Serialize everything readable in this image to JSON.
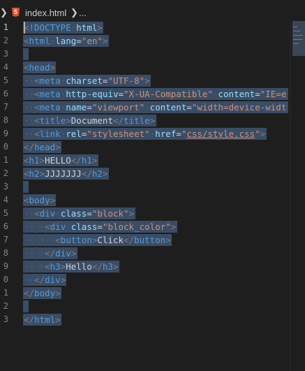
{
  "breadcrumb": {
    "file_icon": "html5-icon",
    "file_name": "index.html",
    "ellipsis": "..."
  },
  "line_numbers": [
    "1",
    "2",
    "3",
    "4",
    "5",
    "6",
    "7",
    "8",
    "9",
    "0",
    "1",
    "2",
    "3",
    "4",
    "5",
    "6",
    "7",
    "8",
    "9",
    "0",
    "1",
    "2",
    "3"
  ],
  "active_line": 1,
  "code_lines": [
    [
      {
        "t": "<",
        "c": "t-punct"
      },
      {
        "t": "!DOCTYPE",
        "c": "t-tag"
      },
      {
        "t": " ",
        "c": "ws"
      },
      {
        "t": "html",
        "c": "t-attr"
      },
      {
        "t": ">",
        "c": "t-punct"
      }
    ],
    [
      {
        "t": "<",
        "c": "t-punct"
      },
      {
        "t": "html",
        "c": "t-tag"
      },
      {
        "t": " ",
        "c": "ws"
      },
      {
        "t": "lang",
        "c": "t-attr"
      },
      {
        "t": "=",
        "c": "t-text"
      },
      {
        "t": "\"en\"",
        "c": "t-str"
      },
      {
        "t": ">",
        "c": "t-punct"
      }
    ],
    [],
    [
      {
        "t": "<",
        "c": "t-punct"
      },
      {
        "t": "head",
        "c": "t-tag"
      },
      {
        "t": ">",
        "c": "t-punct"
      }
    ],
    [
      {
        "t": "  ",
        "c": "ws"
      },
      {
        "t": "<",
        "c": "t-punct"
      },
      {
        "t": "meta",
        "c": "t-tag"
      },
      {
        "t": " ",
        "c": "ws"
      },
      {
        "t": "charset",
        "c": "t-attr"
      },
      {
        "t": "=",
        "c": "t-text"
      },
      {
        "t": "\"UTF-8\"",
        "c": "t-str"
      },
      {
        "t": ">",
        "c": "t-punct"
      }
    ],
    [
      {
        "t": "  ",
        "c": "ws"
      },
      {
        "t": "<",
        "c": "t-punct"
      },
      {
        "t": "meta",
        "c": "t-tag"
      },
      {
        "t": " ",
        "c": "ws"
      },
      {
        "t": "http-equiv",
        "c": "t-attr"
      },
      {
        "t": "=",
        "c": "t-text"
      },
      {
        "t": "\"X-UA-Compatible\"",
        "c": "t-str"
      },
      {
        "t": " ",
        "c": "ws"
      },
      {
        "t": "content",
        "c": "t-attr"
      },
      {
        "t": "=",
        "c": "t-text"
      },
      {
        "t": "\"IE=e",
        "c": "t-str"
      }
    ],
    [
      {
        "t": "  ",
        "c": "ws"
      },
      {
        "t": "<",
        "c": "t-punct"
      },
      {
        "t": "meta",
        "c": "t-tag"
      },
      {
        "t": " ",
        "c": "ws"
      },
      {
        "t": "name",
        "c": "t-attr"
      },
      {
        "t": "=",
        "c": "t-text"
      },
      {
        "t": "\"viewport\"",
        "c": "t-str"
      },
      {
        "t": " ",
        "c": "ws"
      },
      {
        "t": "content",
        "c": "t-attr"
      },
      {
        "t": "=",
        "c": "t-text"
      },
      {
        "t": "\"width=device-widt",
        "c": "t-str"
      }
    ],
    [
      {
        "t": "  ",
        "c": "ws"
      },
      {
        "t": "<",
        "c": "t-punct"
      },
      {
        "t": "title",
        "c": "t-tag"
      },
      {
        "t": ">",
        "c": "t-punct"
      },
      {
        "t": "Document",
        "c": "t-text"
      },
      {
        "t": "</",
        "c": "t-punct"
      },
      {
        "t": "title",
        "c": "t-tag"
      },
      {
        "t": ">",
        "c": "t-punct"
      }
    ],
    [
      {
        "t": "  ",
        "c": "ws"
      },
      {
        "t": "<",
        "c": "t-punct"
      },
      {
        "t": "link",
        "c": "t-tag"
      },
      {
        "t": " ",
        "c": "ws"
      },
      {
        "t": "rel",
        "c": "t-attr"
      },
      {
        "t": "=",
        "c": "t-text"
      },
      {
        "t": "\"stylesheet\"",
        "c": "t-str"
      },
      {
        "t": " ",
        "c": "ws"
      },
      {
        "t": "href",
        "c": "t-attr"
      },
      {
        "t": "=",
        "c": "t-text"
      },
      {
        "t": "\"",
        "c": "t-str"
      },
      {
        "t": "css/style.css",
        "c": "t-link"
      },
      {
        "t": "\"",
        "c": "t-str"
      },
      {
        "t": ">",
        "c": "t-punct"
      }
    ],
    [
      {
        "t": "</",
        "c": "t-punct"
      },
      {
        "t": "head",
        "c": "t-tag"
      },
      {
        "t": ">",
        "c": "t-punct"
      }
    ],
    [
      {
        "t": "<",
        "c": "t-punct"
      },
      {
        "t": "h1",
        "c": "t-tag"
      },
      {
        "t": ">",
        "c": "t-punct"
      },
      {
        "t": "HELLO",
        "c": "t-text"
      },
      {
        "t": "</",
        "c": "t-punct"
      },
      {
        "t": "h1",
        "c": "t-tag"
      },
      {
        "t": ">",
        "c": "t-punct"
      }
    ],
    [
      {
        "t": "<",
        "c": "t-punct"
      },
      {
        "t": "h2",
        "c": "t-tag"
      },
      {
        "t": ">",
        "c": "t-punct"
      },
      {
        "t": "JJJJJJJ",
        "c": "t-text"
      },
      {
        "t": "</",
        "c": "t-punct"
      },
      {
        "t": "h2",
        "c": "t-tag"
      },
      {
        "t": ">",
        "c": "t-punct"
      }
    ],
    [],
    [
      {
        "t": "<",
        "c": "t-punct"
      },
      {
        "t": "body",
        "c": "t-tag"
      },
      {
        "t": ">",
        "c": "t-punct"
      }
    ],
    [
      {
        "t": "  ",
        "c": "ws"
      },
      {
        "t": "<",
        "c": "t-punct"
      },
      {
        "t": "div",
        "c": "t-tag"
      },
      {
        "t": " ",
        "c": "ws"
      },
      {
        "t": "class",
        "c": "t-attr"
      },
      {
        "t": "=",
        "c": "t-text"
      },
      {
        "t": "\"block\"",
        "c": "t-str"
      },
      {
        "t": ">",
        "c": "t-punct"
      }
    ],
    [
      {
        "t": "    ",
        "c": "ws"
      },
      {
        "t": "<",
        "c": "t-punct"
      },
      {
        "t": "div",
        "c": "t-tag"
      },
      {
        "t": " ",
        "c": "ws"
      },
      {
        "t": "class",
        "c": "t-attr"
      },
      {
        "t": "=",
        "c": "t-text"
      },
      {
        "t": "\"block_color\"",
        "c": "t-str"
      },
      {
        "t": ">",
        "c": "t-punct"
      }
    ],
    [
      {
        "t": "      ",
        "c": "ws"
      },
      {
        "t": "<",
        "c": "t-punct"
      },
      {
        "t": "button",
        "c": "t-tag"
      },
      {
        "t": ">",
        "c": "t-punct"
      },
      {
        "t": "Click",
        "c": "t-text"
      },
      {
        "t": "</",
        "c": "t-punct"
      },
      {
        "t": "button",
        "c": "t-tag"
      },
      {
        "t": ">",
        "c": "t-punct"
      }
    ],
    [
      {
        "t": "    ",
        "c": "ws"
      },
      {
        "t": "</",
        "c": "t-punct"
      },
      {
        "t": "div",
        "c": "t-tag"
      },
      {
        "t": ">",
        "c": "t-punct"
      }
    ],
    [
      {
        "t": "    ",
        "c": "ws"
      },
      {
        "t": "<",
        "c": "t-punct"
      },
      {
        "t": "h3",
        "c": "t-tag"
      },
      {
        "t": ">",
        "c": "t-punct"
      },
      {
        "t": "Hello",
        "c": "t-text"
      },
      {
        "t": "</",
        "c": "t-punct"
      },
      {
        "t": "h3",
        "c": "t-tag"
      },
      {
        "t": ">",
        "c": "t-punct"
      }
    ],
    [
      {
        "t": "  ",
        "c": "ws"
      },
      {
        "t": "</",
        "c": "t-punct"
      },
      {
        "t": "div",
        "c": "t-tag"
      },
      {
        "t": ">",
        "c": "t-punct"
      }
    ],
    [
      {
        "t": "</",
        "c": "t-punct"
      },
      {
        "t": "body",
        "c": "t-tag"
      },
      {
        "t": ">",
        "c": "t-punct"
      }
    ],
    [],
    [
      {
        "t": "</",
        "c": "t-punct"
      },
      {
        "t": "html",
        "c": "t-tag"
      },
      {
        "t": ">",
        "c": "t-punct"
      }
    ]
  ],
  "colors": {
    "background": "#1e1e1e",
    "selection": "#3a4d66",
    "tag": "#569cd6",
    "attribute": "#9cdcfe",
    "string": "#ce9178",
    "text": "#d4d4d4",
    "punctuation": "#808080"
  }
}
